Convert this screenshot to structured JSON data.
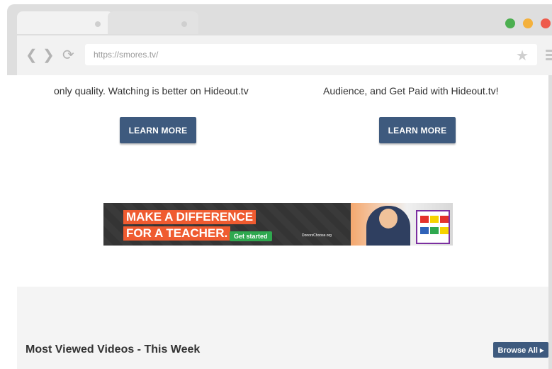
{
  "browser": {
    "url": "https://smores.tv/",
    "icons": {
      "back": "chevron-left-icon",
      "forward": "chevron-right-icon",
      "reload": "reload-icon",
      "bookmark": "star-icon",
      "menu": "menu-icon"
    }
  },
  "promo": {
    "left_text": "only quality. Watching is better on Hideout.tv",
    "right_text": "Audience, and Get Paid with Hideout.tv!",
    "left_button": "LEARN MORE",
    "right_button": "LEARN MORE"
  },
  "banner": {
    "headline_line1": "MAKE A DIFFERENCE",
    "headline_line2": "FOR A TEACHER.",
    "cta": "Get started",
    "logo_text": "DonorsChoose.org"
  },
  "section": {
    "title": "Most Viewed Videos - This Week",
    "browse_label": "Browse All ▸"
  },
  "colors": {
    "button": "#3e5a7e",
    "banner_orange": "#ef5b30",
    "banner_green": "#2fa84f",
    "window_green": "#4caf50",
    "window_yellow": "#f4b13c",
    "window_red": "#ee5b4c"
  }
}
